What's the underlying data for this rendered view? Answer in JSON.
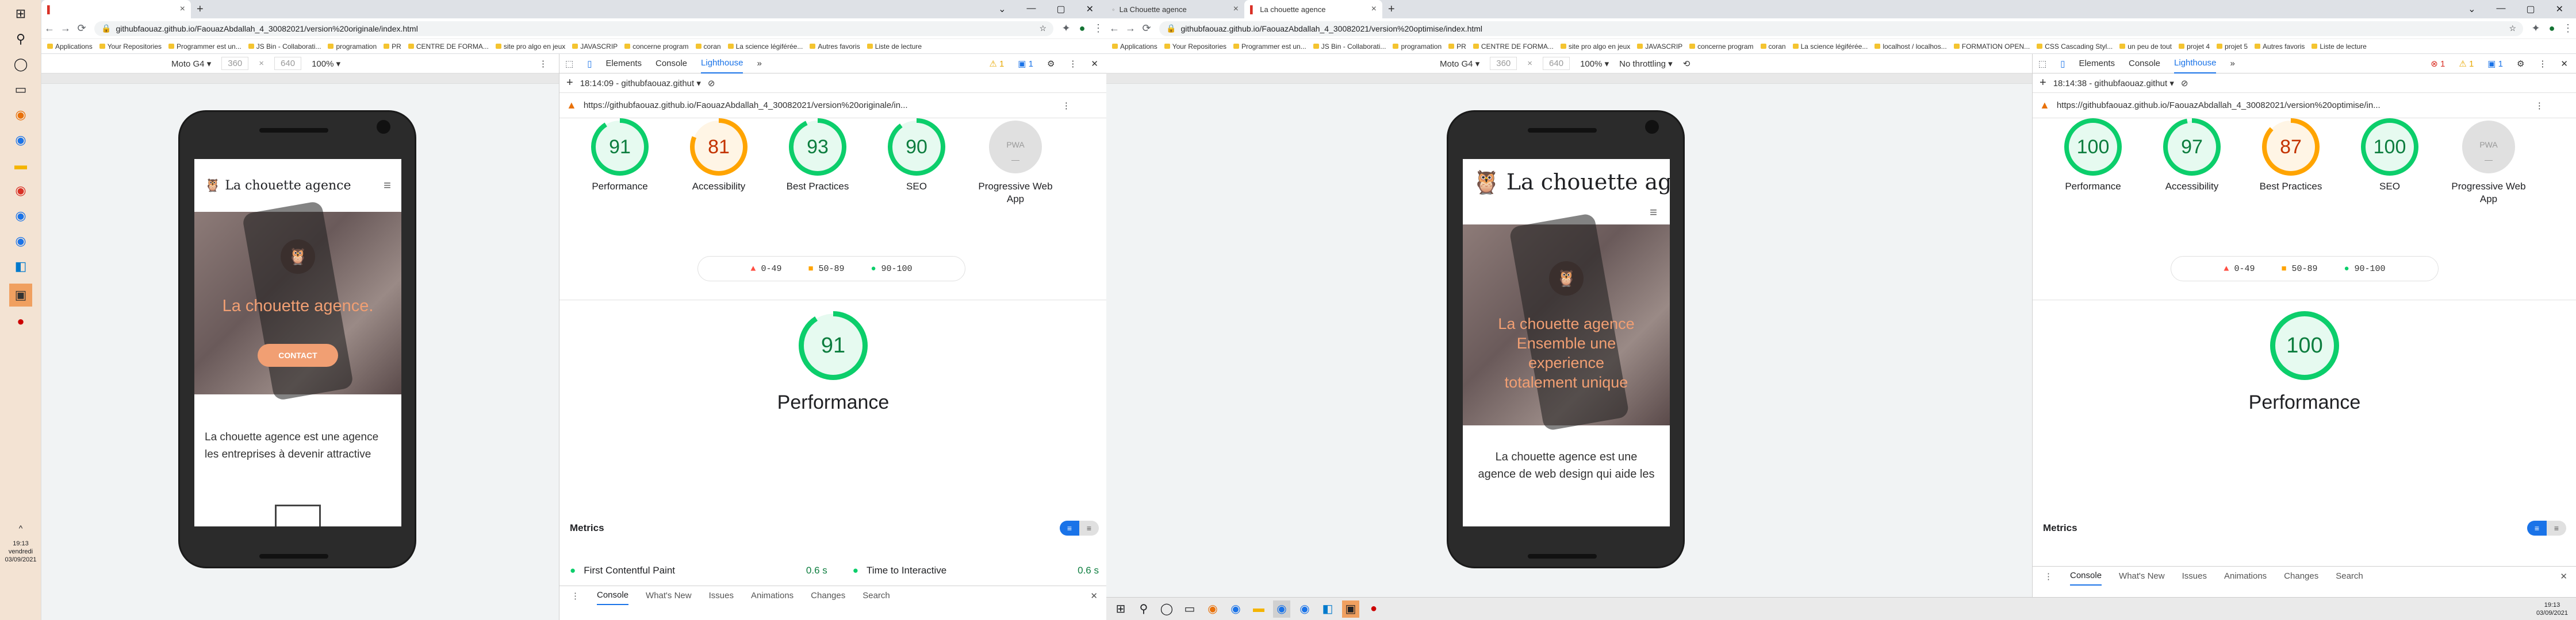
{
  "left_taskbar": {
    "items": [
      "start-icon",
      "search-icon",
      "cortana-icon",
      "task-view-icon",
      "edge-icon",
      "chrome-icon",
      "files-icon",
      "firefox-icon",
      "chrome2-icon",
      "vscode-icon",
      "sublime-icon",
      "opera-icon"
    ],
    "time": "19:13",
    "day": "vendredi",
    "date": "03/09/2021"
  },
  "left_window": {
    "tabs": [
      {
        "title": ""
      },
      {
        "title": ""
      }
    ],
    "url": "githubfaouaz.github.io/FaouazAbdallah_4_30082021/version%20originale/index.html",
    "bookmarks": [
      "Applications",
      "Your Repositories",
      "Programmer est un...",
      "JS Bin - Collaborati...",
      "programation",
      "PR",
      "CENTRE DE FORMA...",
      "site pro algo en jeux",
      "JAVASCRIP",
      "concerne program",
      "coran",
      "La science légiférée...",
      "Autres favoris",
      "Liste de lecture"
    ],
    "device": {
      "name": "Moto G4",
      "width": "360",
      "height": "640",
      "zoom": "100%"
    },
    "site": {
      "logo_text": "La chouette agence",
      "hero_text": "La chouette agence.",
      "cta": "CONTACT",
      "body_text_1": "La chouette agence est une agence",
      "body_text_2": "les entreprises à devenir attractive"
    },
    "devtools": {
      "tabs": [
        "Elements",
        "Console",
        "Lighthouse"
      ],
      "active_tab": "Lighthouse",
      "warn_count": "1",
      "info_count": "1",
      "report_time": "18:14:09 - githubfaouaz.githut",
      "report_url": "https://githubfaouaz.github.io/FaouazAbdallah_4_30082021/version%20originale/in...",
      "scores": [
        {
          "label": "Performance",
          "value": "91",
          "pct": 0.91,
          "color": "#0cce6b"
        },
        {
          "label": "Accessibility",
          "value": "81",
          "pct": 0.81,
          "color": "#ffa400"
        },
        {
          "label": "Best Practices",
          "value": "93",
          "pct": 0.93,
          "color": "#0cce6b"
        },
        {
          "label": "SEO",
          "value": "90",
          "pct": 0.9,
          "color": "#0cce6b"
        },
        {
          "label": "Progressive Web App",
          "value": "",
          "pct": 0,
          "color": "#999"
        }
      ],
      "legend": [
        "0-49",
        "50-89",
        "90-100"
      ],
      "big_score": "91",
      "big_label": "Performance",
      "metrics_label": "Metrics",
      "metric_rows": [
        {
          "label": "First Contentful Paint",
          "value": "0.6 s"
        },
        {
          "label": "Time to Interactive",
          "value": "0.6 s"
        }
      ],
      "drawer_tabs": [
        "Console",
        "What's New",
        "Issues",
        "Animations",
        "Changes",
        "Search"
      ]
    }
  },
  "right_window": {
    "tabs": [
      {
        "title": "La Chouette agence"
      },
      {
        "title": "La chouette agence"
      }
    ],
    "url": "githubfaouaz.github.io/FaouazAbdallah_4_30082021/version%20optimise/index.html",
    "bookmarks": [
      "Applications",
      "Your Repositories",
      "Programmer est un...",
      "JS Bin - Collaborati...",
      "programation",
      "PR",
      "CENTRE DE FORMA...",
      "site pro algo en jeux",
      "JAVASCRIP",
      "concerne program",
      "coran",
      "La science légiférée...",
      "localhost / localhos...",
      "FORMATION OPEN...",
      "CSS Cascading Styl...",
      "un peu de tout",
      "projet 4",
      "projet 5",
      "Autres favoris",
      "Liste de lecture"
    ],
    "device": {
      "name": "Moto G4",
      "width": "360",
      "height": "640",
      "zoom": "100%",
      "throttle": "No throttling"
    },
    "site": {
      "logo_text": "La chouette agen",
      "hero_line1": "La chouette agence",
      "hero_line2": "Ensemble une",
      "hero_line3": "experience",
      "hero_line4": "totalement unique",
      "body_text_1": "La chouette agence est une",
      "body_text_2": "agence de web design qui aide les"
    },
    "devtools": {
      "tabs": [
        "Elements",
        "Console",
        "Lighthouse"
      ],
      "active_tab": "Lighthouse",
      "err_count": "1",
      "warn_count": "1",
      "info_count": "1",
      "report_time": "18:14:38 - githubfaouaz.githut",
      "report_url": "https://githubfaouaz.github.io/FaouazAbdallah_4_30082021/version%20optimise/in...",
      "scores": [
        {
          "label": "Performance",
          "value": "100",
          "pct": 1.0,
          "color": "#0cce6b"
        },
        {
          "label": "Accessibility",
          "value": "97",
          "pct": 0.97,
          "color": "#0cce6b"
        },
        {
          "label": "Best Practices",
          "value": "87",
          "pct": 0.87,
          "color": "#ffa400"
        },
        {
          "label": "SEO",
          "value": "100",
          "pct": 1.0,
          "color": "#0cce6b"
        },
        {
          "label": "Progressive Web App",
          "value": "",
          "pct": 0,
          "color": "#999"
        }
      ],
      "legend": [
        "0-49",
        "50-89",
        "90-100"
      ],
      "big_score": "100",
      "big_label": "Performance",
      "metrics_label": "Metrics",
      "drawer_tabs": [
        "Console",
        "What's New",
        "Issues",
        "Animations",
        "Changes",
        "Search"
      ]
    }
  },
  "bottom_taskbar": {
    "time": "19:13",
    "date": "03/09/2021"
  }
}
